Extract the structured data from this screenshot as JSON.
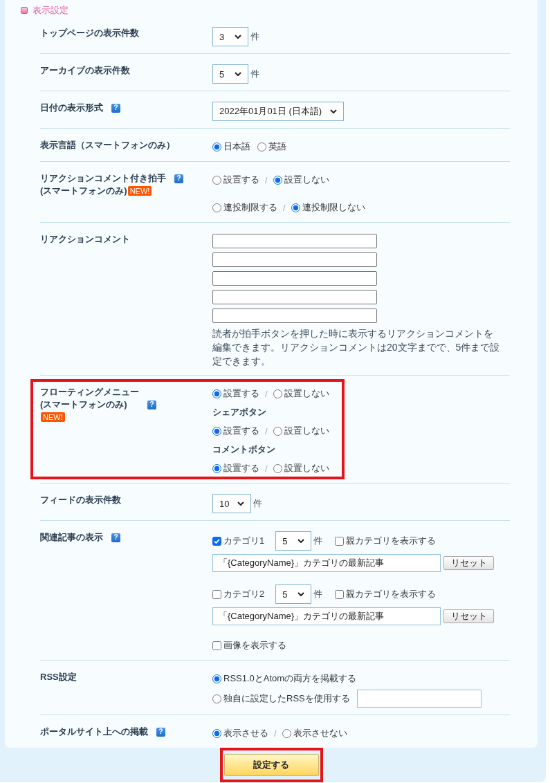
{
  "section": {
    "title": "表示設定"
  },
  "rows": [
    {
      "label_lines": [
        {
          "text": "トップページの表示件数"
        }
      ],
      "groups": [
        {
          "lines": [
            {
              "items": [
                {
                  "kind": "select",
                  "value": "3"
                },
                {
                  "kind": "unit",
                  "text": "件"
                }
              ]
            }
          ]
        }
      ]
    },
    {
      "label_lines": [
        {
          "text": "アーカイブの表示件数"
        }
      ],
      "groups": [
        {
          "lines": [
            {
              "items": [
                {
                  "kind": "select",
                  "value": "5"
                },
                {
                  "kind": "unit",
                  "text": "件"
                }
              ]
            }
          ]
        }
      ]
    },
    {
      "label_lines": [
        {
          "text": "日付の表示形式",
          "help": "?"
        }
      ],
      "groups": [
        {
          "lines": [
            {
              "items": [
                {
                  "kind": "select",
                  "value": "2022年01月01日 (日本語)"
                }
              ]
            }
          ]
        }
      ]
    },
    {
      "label_lines": [
        {
          "text": "表示言語（スマートフォンのみ）"
        }
      ],
      "groups": [
        {
          "lines": [
            {
              "items": [
                {
                  "kind": "radio",
                  "label": "日本語",
                  "selected": true
                },
                {
                  "kind": "radio",
                  "label": "英語",
                  "selected": false
                }
              ]
            }
          ]
        }
      ]
    },
    {
      "label_lines": [
        {
          "text": "リアクションコメント付き拍手",
          "help": "?"
        },
        {
          "text": "(スマートフォンのみ)",
          "badge": "NEW!"
        }
      ],
      "groups": [
        {
          "lines": [
            {
              "items": [
                {
                  "kind": "radio",
                  "label": "設置する",
                  "selected": false
                },
                {
                  "kind": "separator",
                  "text": "/"
                },
                {
                  "kind": "radio",
                  "label": "設置しない",
                  "selected": true
                }
              ]
            }
          ]
        },
        {
          "lines": [
            {
              "items": [
                {
                  "kind": "radio",
                  "label": "連投制限する",
                  "selected": false
                },
                {
                  "kind": "separator",
                  "text": "/"
                },
                {
                  "kind": "radio",
                  "label": "連投制限しない",
                  "selected": true
                }
              ]
            }
          ]
        }
      ]
    },
    {
      "label_lines": [
        {
          "text": "リアクションコメント"
        }
      ],
      "groups": [
        {
          "lines": [
            {
              "items": [
                {
                  "kind": "input"
                }
              ]
            },
            {
              "items": [
                {
                  "kind": "input"
                }
              ]
            },
            {
              "items": [
                {
                  "kind": "input"
                }
              ]
            },
            {
              "items": [
                {
                  "kind": "input"
                }
              ]
            },
            {
              "items": [
                {
                  "kind": "input"
                }
              ]
            },
            {
              "items": [
                {
                  "kind": "note",
                  "text": "読者が拍手ボタンを押した時に表示するリアクションコメントを編集できます。リアクションコメントは20文字までで、5件まで設定できます。"
                }
              ]
            }
          ]
        }
      ]
    },
    {
      "label_lines": [
        {
          "text": "フローティングメニュー"
        },
        {
          "text": "(スマートフォンのみ)",
          "help": "?"
        },
        {
          "badge": "NEW!"
        }
      ],
      "highlighted": true,
      "groups": [
        {
          "lines": [
            {
              "items": [
                {
                  "kind": "radio",
                  "label": "設置する",
                  "selected": true
                },
                {
                  "kind": "separator",
                  "text": "/"
                },
                {
                  "kind": "radio",
                  "label": "設置しない",
                  "selected": false
                }
              ]
            },
            {
              "items": [
                {
                  "kind": "heading",
                  "text": "シェアボタン"
                }
              ]
            },
            {
              "items": [
                {
                  "kind": "radio",
                  "label": "設置する",
                  "selected": true
                },
                {
                  "kind": "separator",
                  "text": "/"
                },
                {
                  "kind": "radio",
                  "label": "設置しない",
                  "selected": false
                }
              ]
            },
            {
              "items": [
                {
                  "kind": "heading",
                  "text": "コメントボタン"
                }
              ]
            },
            {
              "items": [
                {
                  "kind": "radio",
                  "label": "設置する",
                  "selected": true
                },
                {
                  "kind": "separator",
                  "text": "/"
                },
                {
                  "kind": "radio",
                  "label": "設置しない",
                  "selected": false
                }
              ]
            }
          ]
        }
      ]
    },
    {
      "label_lines": [
        {
          "text": "フィードの表示件数"
        }
      ],
      "groups": [
        {
          "lines": [
            {
              "items": [
                {
                  "kind": "select",
                  "value": "10"
                },
                {
                  "kind": "unit",
                  "text": "件"
                }
              ]
            }
          ]
        }
      ]
    },
    {
      "label_lines": [
        {
          "text": "関連記事の表示",
          "help": "?"
        }
      ],
      "groups": [
        {
          "lines": [
            {
              "items": [
                {
                  "kind": "checkbox",
                  "label": "カテゴリ1",
                  "checked": true
                },
                {
                  "kind": "select",
                  "value": "5"
                },
                {
                  "kind": "unit",
                  "text": "件"
                },
                {
                  "kind": "checkbox",
                  "label": "親カテゴリを表示する",
                  "checked": false
                }
              ]
            },
            {
              "items": [
                {
                  "kind": "input",
                  "value": "「{CategoryName}」カテゴリの最新記事"
                },
                {
                  "kind": "button",
                  "label": "リセット"
                }
              ]
            }
          ]
        },
        {
          "lines": [
            {
              "items": [
                {
                  "kind": "checkbox",
                  "label": "カテゴリ2",
                  "checked": false
                },
                {
                  "kind": "select",
                  "value": "5"
                },
                {
                  "kind": "unit",
                  "text": "件"
                },
                {
                  "kind": "checkbox",
                  "label": "親カテゴリを表示する",
                  "checked": false
                }
              ]
            },
            {
              "items": [
                {
                  "kind": "input",
                  "value": "「{CategoryName}」カテゴリの最新記事"
                },
                {
                  "kind": "button",
                  "label": "リセット"
                }
              ]
            }
          ]
        },
        {
          "lines": [
            {
              "items": [
                {
                  "kind": "checkbox",
                  "label": "画像を表示する",
                  "checked": false
                }
              ]
            }
          ]
        }
      ]
    },
    {
      "label_lines": [
        {
          "text": "RSS設定"
        }
      ],
      "groups": [
        {
          "lines": [
            {
              "items": [
                {
                  "kind": "radio",
                  "label": "RSS1.0とAtomの両方を掲載する",
                  "selected": true
                }
              ]
            },
            {
              "items": [
                {
                  "kind": "radio",
                  "label": "独自に設定したRSSを使用する",
                  "selected": false
                },
                {
                  "kind": "input"
                }
              ]
            }
          ]
        }
      ]
    },
    {
      "label_lines": [
        {
          "text": "ポータルサイト上への掲載",
          "help": "?"
        }
      ],
      "groups": [
        {
          "lines": [
            {
              "items": [
                {
                  "kind": "radio",
                  "label": "表示させる",
                  "selected": true
                },
                {
                  "kind": "separator",
                  "text": "/"
                },
                {
                  "kind": "radio",
                  "label": "表示させない",
                  "selected": false
                }
              ]
            }
          ]
        }
      ]
    }
  ],
  "submit": {
    "label": "設定する",
    "highlighted": true
  }
}
